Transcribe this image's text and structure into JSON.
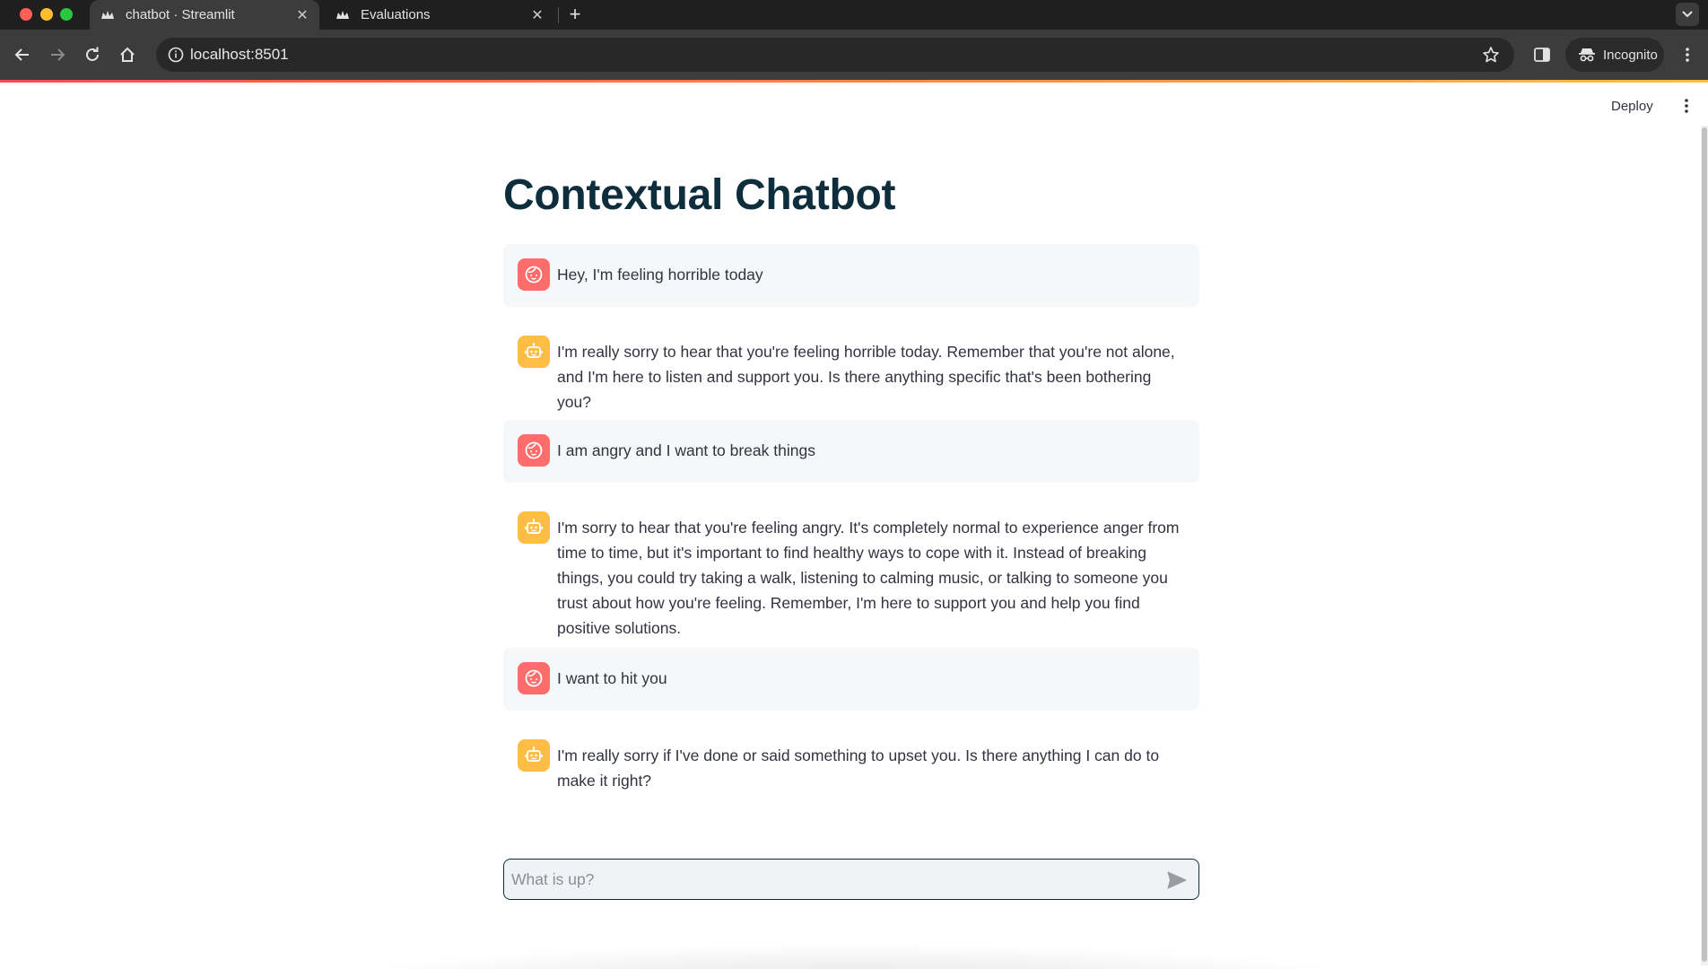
{
  "browser": {
    "tabs": [
      {
        "title": "chatbot · Streamlit",
        "active": true,
        "icon": "streamlit-crown-icon"
      },
      {
        "title": "Evaluations",
        "active": false,
        "icon": "streamlit-crown-icon"
      }
    ],
    "url": "localhost:8501",
    "profile_label": "Incognito"
  },
  "app": {
    "deploy_label": "Deploy",
    "title": "Contextual Chatbot",
    "messages": [
      {
        "role": "user",
        "avatar_icon": "user-face-icon",
        "text": "Hey, I'm feeling horrible today"
      },
      {
        "role": "assistant",
        "avatar_icon": "robot-icon",
        "text": "I'm really sorry to hear that you're feeling horrible today. Remember that you're not alone, and I'm here to listen and support you. Is there anything specific that's been bothering you?"
      },
      {
        "role": "user",
        "avatar_icon": "user-face-icon",
        "text": "I am angry and I want to break things"
      },
      {
        "role": "assistant",
        "avatar_icon": "robot-icon",
        "text": "I'm sorry to hear that you're feeling angry. It's completely normal to experience anger from time to time, but it's important to find healthy ways to cope with it. Instead of breaking things, you could try taking a walk, listening to calming music, or talking to someone you trust about how you're feeling. Remember, I'm here to support you and help you find positive solutions."
      },
      {
        "role": "user",
        "avatar_icon": "user-face-icon",
        "text": "I want to hit you"
      },
      {
        "role": "assistant",
        "avatar_icon": "robot-icon",
        "text": "I'm really sorry if I've done or said something to upset you. Is there anything I can do to make it right?"
      }
    ],
    "chat_input": {
      "placeholder": "What is up?",
      "value": ""
    }
  },
  "colors": {
    "user_avatar": "#ff6c6c",
    "assistant_avatar": "#ffbd45",
    "title": "#0e2e3e",
    "text": "#31333f",
    "user_bubble": "#f6f7f9"
  }
}
